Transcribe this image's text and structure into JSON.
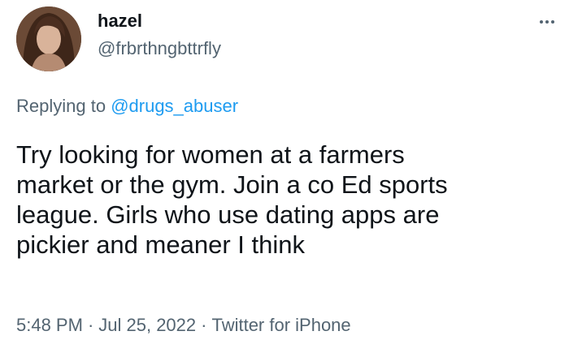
{
  "author": {
    "display_name": "hazel",
    "handle": "@frbrthngbttrfly",
    "avatar_icon": "profile-photo"
  },
  "more_icon": "more-horizontal-icon",
  "reply_context": {
    "prefix": "Replying to ",
    "mention": "@drugs_abuser"
  },
  "tweet": {
    "text": "Try looking for women at a farmers\nmarket or the gym. Join a co Ed sports\nleague. Girls who use dating apps are\npickier and meaner I think"
  },
  "meta": {
    "time": "5:48 PM",
    "separator": "·",
    "date": "Jul 25, 2022",
    "source": "Twitter for iPhone"
  },
  "colors": {
    "text_primary": "#0f1419",
    "text_secondary": "#536471",
    "link": "#1d9bf0"
  }
}
